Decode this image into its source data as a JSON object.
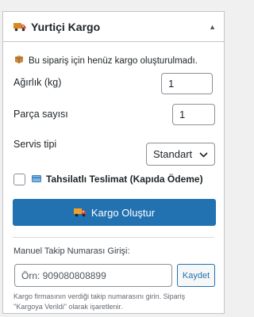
{
  "panel": {
    "title": "Yurtiçi Kargo",
    "collapse_icon": "triangle-up-icon"
  },
  "notice": {
    "icon": "package-icon",
    "text": "Bu sipariş için henüz kargo oluşturulmadı."
  },
  "weight": {
    "label": "Ağırlık (kg)",
    "value": "1"
  },
  "pieces": {
    "label": "Parça sayısı",
    "value": "1"
  },
  "service": {
    "label": "Servis tipi",
    "selected": "Standart"
  },
  "cod": {
    "label": "Tahsilatlı Teslimat (Kapıda Ödeme)",
    "checked": false
  },
  "create_button": {
    "label": "Kargo Oluştur",
    "icon": "truck-icon"
  },
  "manual": {
    "label": "Manuel Takip Numarası Girişi:",
    "placeholder": "Örn: 909080808899",
    "value": "",
    "save_label": "Kaydet",
    "help": "Kargo firmasının verdiği takip numarasını girin. Sipariş \"Kargoya Verildi\" olarak işaretlenir."
  },
  "colors": {
    "primary": "#2271b1",
    "border": "#c3c4c7",
    "background": "#f0f0f1"
  }
}
